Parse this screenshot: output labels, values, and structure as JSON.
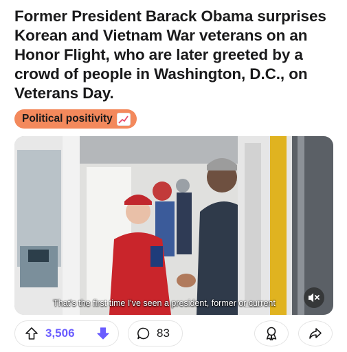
{
  "post": {
    "title": "Former President Barack Obama surprises Korean and Vietnam War veterans on an Honor Flight, who are later greeted by a crowd of people in Washington, D.C., on Veterans Day.",
    "flair": {
      "label": "Political positivity",
      "emoji_icon": "chart-increasing-icon",
      "color": "#f3895c"
    }
  },
  "video": {
    "caption": "That's the first time I've seen a president, former or current",
    "mute_icon": "speaker-muted-icon"
  },
  "actions": {
    "upvote_icon": "arrow-up-icon",
    "vote_count": "3,506",
    "downvote_icon": "arrow-down-icon",
    "downvote_color": "#6a5cff",
    "comment_icon": "speech-bubble-icon",
    "comment_count": "83",
    "award_icon": "award-icon",
    "share_icon": "share-arrow-icon"
  }
}
